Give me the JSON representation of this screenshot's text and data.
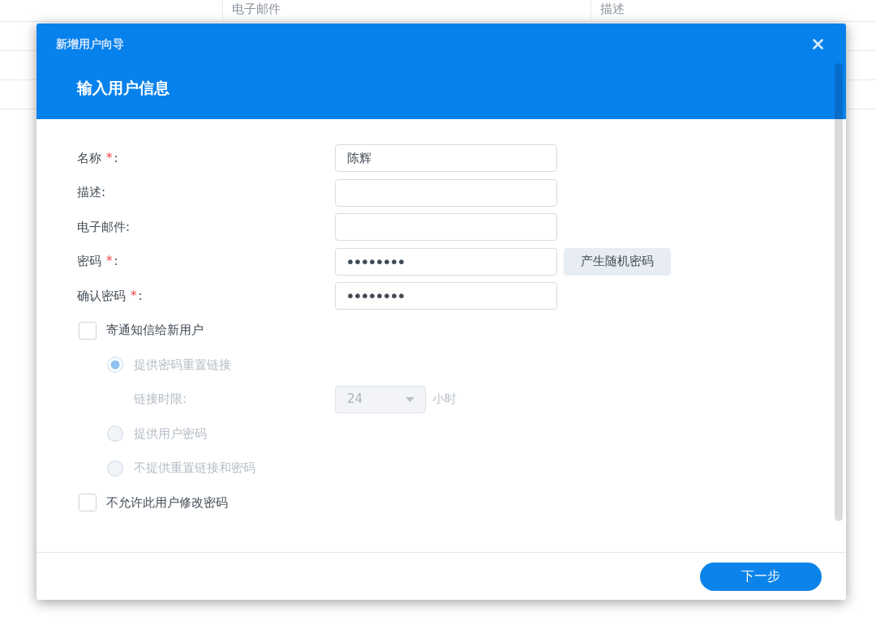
{
  "background_table": {
    "column_headers": [
      "电子邮件",
      "描述"
    ]
  },
  "dialog": {
    "title": "新增用户向导",
    "step_title": "输入用户信息",
    "fields": [
      {
        "kind": "text",
        "label": "名称",
        "required_mark": "*",
        "colon": ":",
        "value": "陈辉"
      },
      {
        "kind": "text",
        "label": "描述",
        "colon": ":"
      },
      {
        "kind": "text",
        "label": "电子邮件",
        "colon": ":"
      },
      {
        "kind": "password",
        "label": "密码",
        "required_mark": "*",
        "colon": ":",
        "value": "••••••••",
        "button": "产生随机密码"
      },
      {
        "kind": "password",
        "label": "确认密码",
        "required_mark": "*",
        "colon": ":",
        "value": "••••••••"
      }
    ],
    "options": [
      {
        "kind": "checkbox",
        "label": "寄通知信给新用户",
        "checked": false,
        "children": [
          {
            "kind": "radio",
            "label": "提供密码重置链接",
            "selected": true,
            "disabled": true
          },
          {
            "kind": "select",
            "label": "链接时限:",
            "value": "24",
            "unit": "小时",
            "disabled": true
          },
          {
            "kind": "radio",
            "label": "提供用户密码",
            "selected": false,
            "disabled": true
          },
          {
            "kind": "radio",
            "label": "不提供重置链接和密码",
            "selected": false,
            "disabled": true
          }
        ]
      },
      {
        "kind": "checkbox",
        "label": "不允许此用户修改密码",
        "checked": false
      }
    ],
    "next_button": "下一步"
  }
}
